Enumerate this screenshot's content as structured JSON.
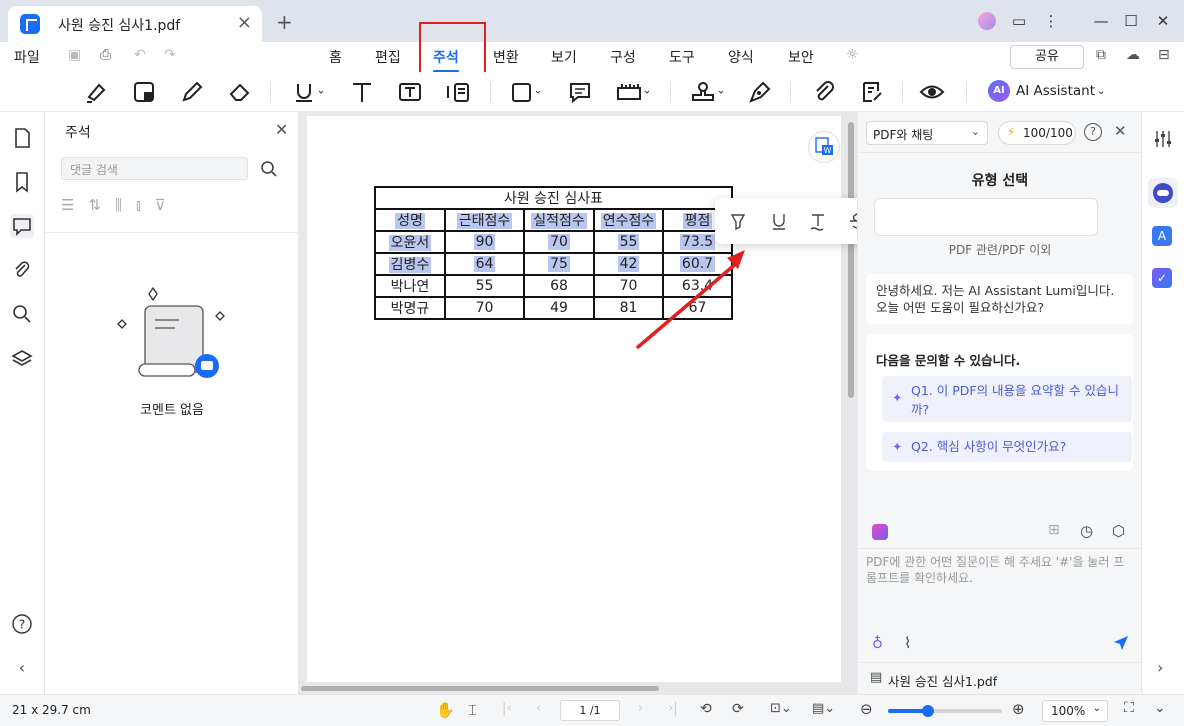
{
  "window": {
    "tab_title": "사원 승진 심사1.pdf"
  },
  "menu": {
    "file": "파일",
    "items": [
      "홈",
      "편집",
      "주석",
      "변환",
      "보기",
      "구성",
      "도구",
      "양식",
      "보안"
    ],
    "active": "주석",
    "share": "공유"
  },
  "toolbar": {
    "ai_assistant": "AI Assistant",
    "ai_badge": "AI"
  },
  "comments": {
    "title": "주석",
    "search_placeholder": "댓글 검색",
    "empty_text": "코멘트 없음"
  },
  "document": {
    "table": {
      "title": "사원 승진 심사표",
      "headers": [
        "성명",
        "근태점수",
        "실적점수",
        "연수점수",
        "평점"
      ],
      "rows": [
        [
          "오윤서",
          "90",
          "70",
          "55",
          "73.5"
        ],
        [
          "김병수",
          "64",
          "75",
          "42",
          "60.7"
        ],
        [
          "박나연",
          "55",
          "68",
          "70",
          "63.4"
        ],
        [
          "박명규",
          "70",
          "49",
          "81",
          "67"
        ]
      ],
      "highlighted_rows": 3
    }
  },
  "ai_panel": {
    "mode_select": "PDF와 채팅",
    "credits": "100/100",
    "heading": "유형 선택",
    "subtext": "PDF 관련/PDF 이외",
    "greeting": "안녕하세요. 저는 AI Assistant Lumi입니다. 오늘 어떤 도움이 필요하신가요?",
    "suggest_title": "다음을 문의할 수 있습니다.",
    "questions": [
      "Q1. 이 PDF의 내용을 요약할 수 있습니까?",
      "Q2. 핵심 사항이 무엇인가요?"
    ],
    "input_placeholder": "PDF에 관한 어떤 질문이든 해 주세요 '#'을 눌러 프롬프트를 확인하세요.",
    "file_name": "사원 승진 심사1.pdf"
  },
  "status": {
    "page_size": "21 x 29.7 cm",
    "page_indicator": "1 /1",
    "zoom": "100%",
    "zoom_fraction": 0.35
  },
  "colors": {
    "accent": "#1a6cf5",
    "highlight": "#b8c6f0",
    "annotation_red": "#e02020"
  }
}
